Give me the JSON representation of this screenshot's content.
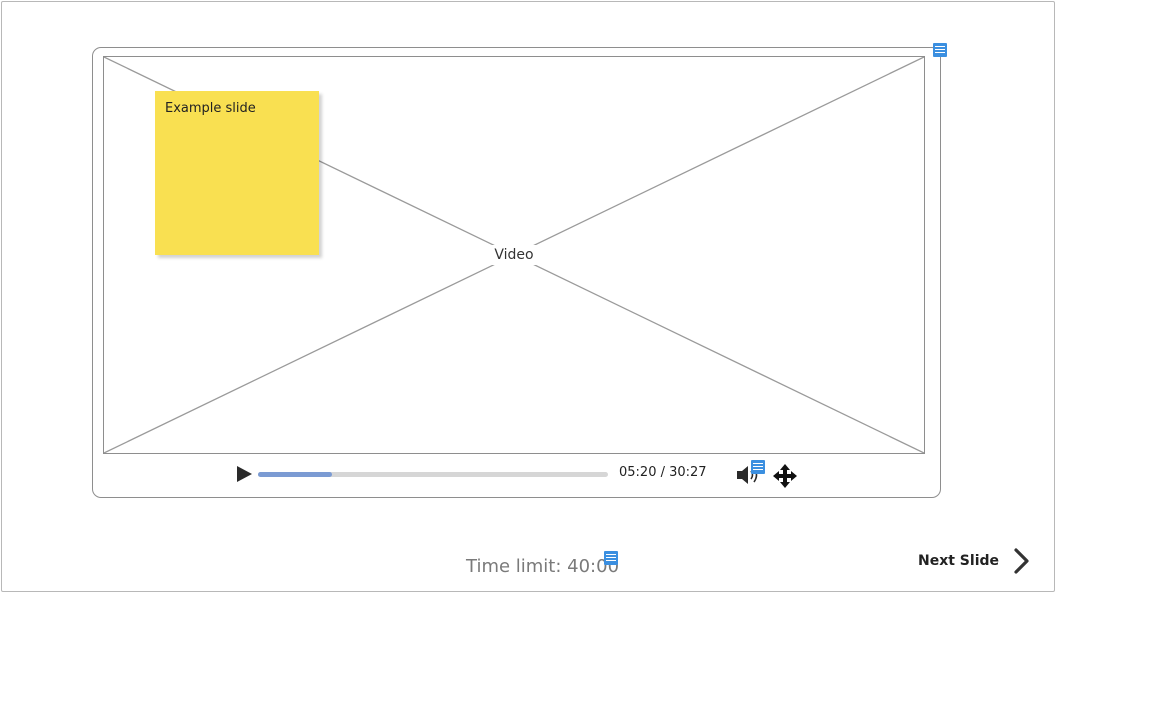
{
  "video": {
    "label": "Video"
  },
  "sticky_note": {
    "text": "Example slide",
    "color": "#f9e051"
  },
  "player_controls": {
    "time_current": "05:20",
    "time_total": "30:27",
    "time_display": "05:20 / 30:27",
    "progress_fraction": 0.21,
    "progress_color": "#7b9bd3",
    "icons": [
      "play-icon",
      "volume-icon",
      "fullscreen-move-icon"
    ]
  },
  "footer": {
    "time_limit": "Time limit: 40:00",
    "next_slide_label": "Next Slide",
    "next_icon": "chevron-right-icon"
  },
  "annotation_color": "#3b8fe0"
}
